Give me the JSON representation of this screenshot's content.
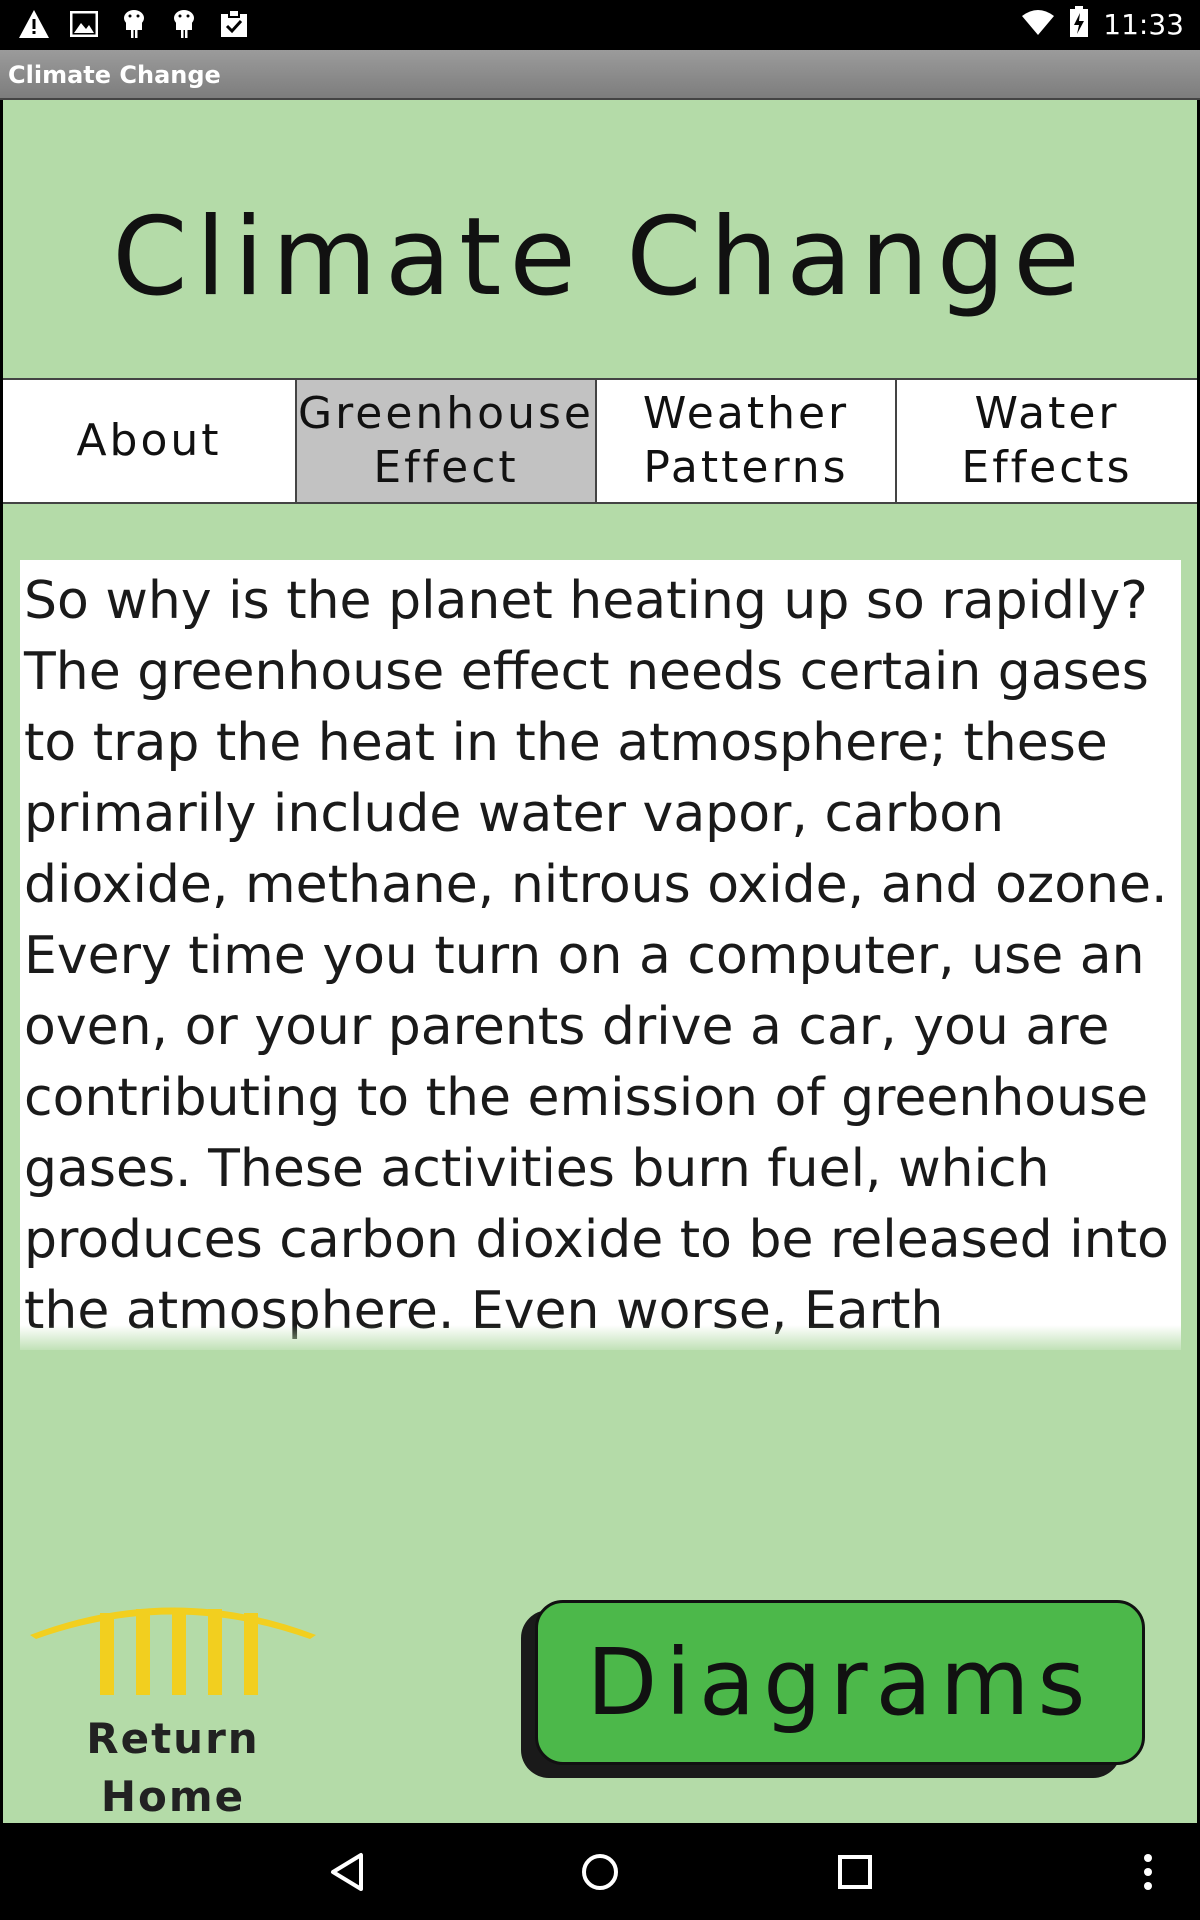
{
  "status_bar": {
    "time": "11:33",
    "left_icons": [
      "warning-icon",
      "image-icon",
      "android-icon",
      "android-icon",
      "clipboard-check-icon"
    ],
    "right_icons": [
      "wifi-icon",
      "battery-icon"
    ]
  },
  "title_bar": {
    "title": "Climate Change"
  },
  "header": {
    "title": "Climate Change"
  },
  "tabs": [
    {
      "label": "About",
      "selected": false
    },
    {
      "label": "Greenhouse\nEffect",
      "selected": true
    },
    {
      "label": "Weather\nPatterns",
      "selected": false
    },
    {
      "label": "Water\nEffects",
      "selected": false
    }
  ],
  "body_text": "So why is the planet heating up so rapidly? The greenhouse effect needs certain gases to trap the heat in the atmosphere; these primarily include water vapor, carbon dioxide, methane, nitrous oxide, and ozone. Every time you turn on a computer, use an oven, or your parents drive a car, you are contributing to the emission of greenhouse gases. These activities burn fuel, which produces carbon dioxide to be released into the atmosphere.  Even worse, Earth",
  "home_button": {
    "label": "Return\nHome",
    "icon": "pillar-arch-icon"
  },
  "diagrams_button": {
    "label": "Diagrams"
  },
  "colors": {
    "background": "#b4dba8",
    "selected_tab": "#c2c2c2",
    "diagrams_green": "#4cb84a",
    "home_yellow": "#f2cf1f"
  },
  "nav_bar": {
    "icons": [
      "back-icon",
      "home-icon",
      "recents-icon",
      "overflow-menu-icon"
    ]
  }
}
